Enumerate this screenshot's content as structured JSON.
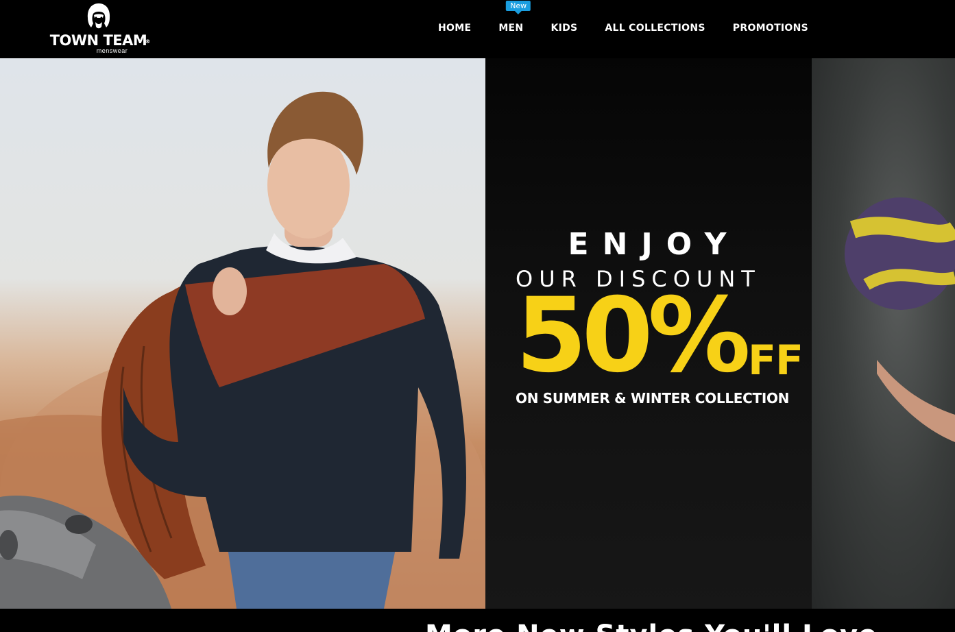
{
  "brand": {
    "name": "TOWN TEAM",
    "registered": "®",
    "tagline": "menswear"
  },
  "nav": {
    "items": [
      {
        "label": "HOME"
      },
      {
        "label": "MEN",
        "badge": "New"
      },
      {
        "label": "KIDS"
      },
      {
        "label": "ALL COLLECTIONS"
      },
      {
        "label": "PROMOTIONS"
      }
    ]
  },
  "hero": {
    "line1": "ENJOY",
    "line2": "OUR DISCOUNT",
    "percent": "50%",
    "off": "FF",
    "line4": "ON SUMMER & WINTER COLLECTION"
  },
  "below": {
    "heading": "More New Styles You'll Love"
  },
  "colors": {
    "badge": "#1a9ee0",
    "accent_yellow": "#f7d117",
    "header_bg": "#000000"
  }
}
